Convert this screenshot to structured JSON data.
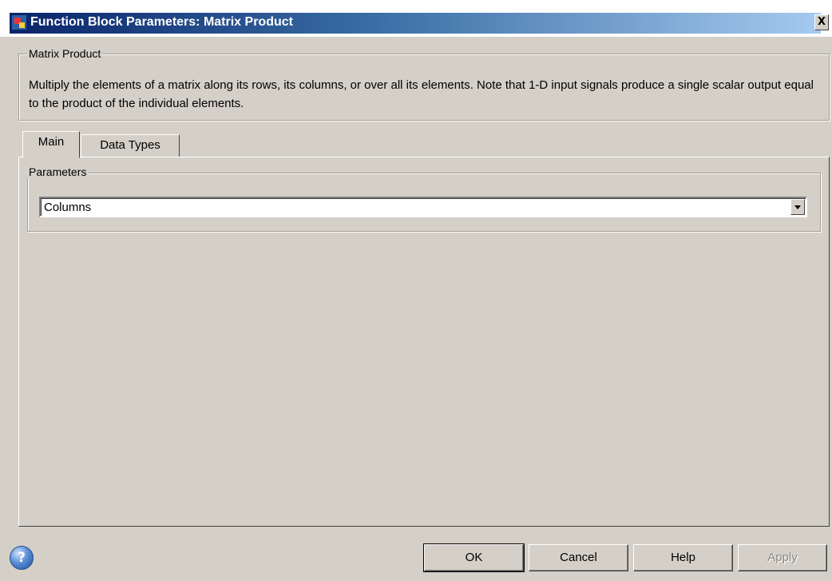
{
  "window": {
    "title": "Function Block Parameters: Matrix Product",
    "close_label": "X"
  },
  "block": {
    "group_label": "Matrix Product",
    "description": "Multiply the elements of a matrix along its rows, its columns, or over all its elements. Note that 1-D input signals produce a single scalar output equal to the product of the individual elements."
  },
  "tabs": [
    {
      "label": "Main",
      "active": true
    },
    {
      "label": "Data Types",
      "active": false
    }
  ],
  "parameters": {
    "group_label": "Parameters",
    "multiply_along": {
      "selected": "Columns"
    }
  },
  "footer": {
    "help_icon": "?",
    "buttons": {
      "ok": "OK",
      "cancel": "Cancel",
      "help": "Help",
      "apply": "Apply"
    },
    "apply_enabled": false
  }
}
